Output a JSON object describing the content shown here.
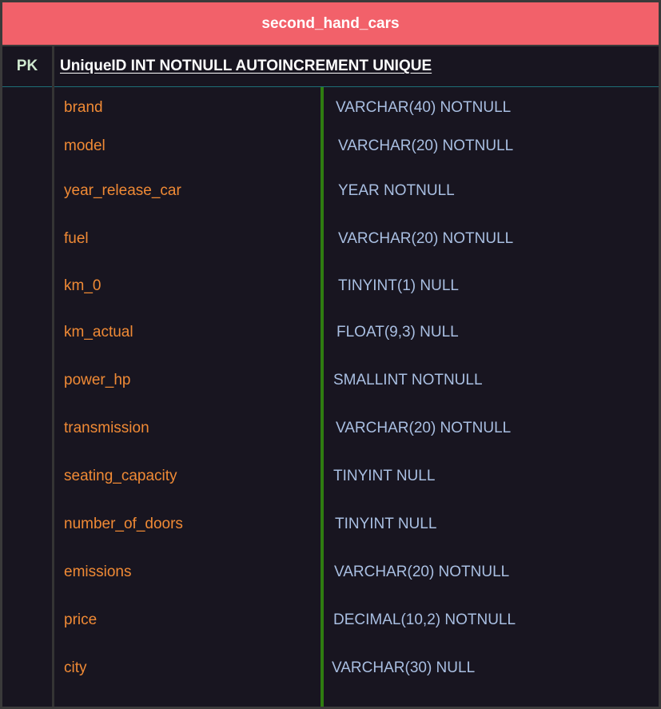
{
  "table": {
    "name": "second_hand_cars",
    "pk_label": "PK",
    "pk_definition": "UniqueID INT NOTNULL AUTOINCREMENT UNIQUE",
    "fields": [
      {
        "name": "brand",
        "type": "VARCHAR(40) NOTNULL"
      },
      {
        "name": "model",
        "type": "VARCHAR(20) NOTNULL"
      },
      {
        "name": "year_release_car",
        "type": "YEAR NOTNULL"
      },
      {
        "name": "fuel",
        "type": "VARCHAR(20) NOTNULL"
      },
      {
        "name": "km_0",
        "type": "TINYINT(1) NULL"
      },
      {
        "name": "km_actual",
        "type": "FLOAT(9,3) NULL"
      },
      {
        "name": "power_hp",
        "type": "SMALLINT NOTNULL"
      },
      {
        "name": "transmission",
        "type": "VARCHAR(20) NOTNULL"
      },
      {
        "name": "seating_capacity",
        "type": "TINYINT NULL"
      },
      {
        "name": "number_of_doors",
        "type": "TINYINT NULL"
      },
      {
        "name": "emissions",
        "type": "VARCHAR(20) NOTNULL"
      },
      {
        "name": "price",
        "type": "DECIMAL(10,2) NOTNULL"
      },
      {
        "name": "city",
        "type": "VARCHAR(30) NULL"
      }
    ]
  },
  "colors": {
    "header_background": "#f2616a",
    "field_name": "#f08a35",
    "field_type": "#a9bfe2",
    "divider": "#2f7d11"
  }
}
